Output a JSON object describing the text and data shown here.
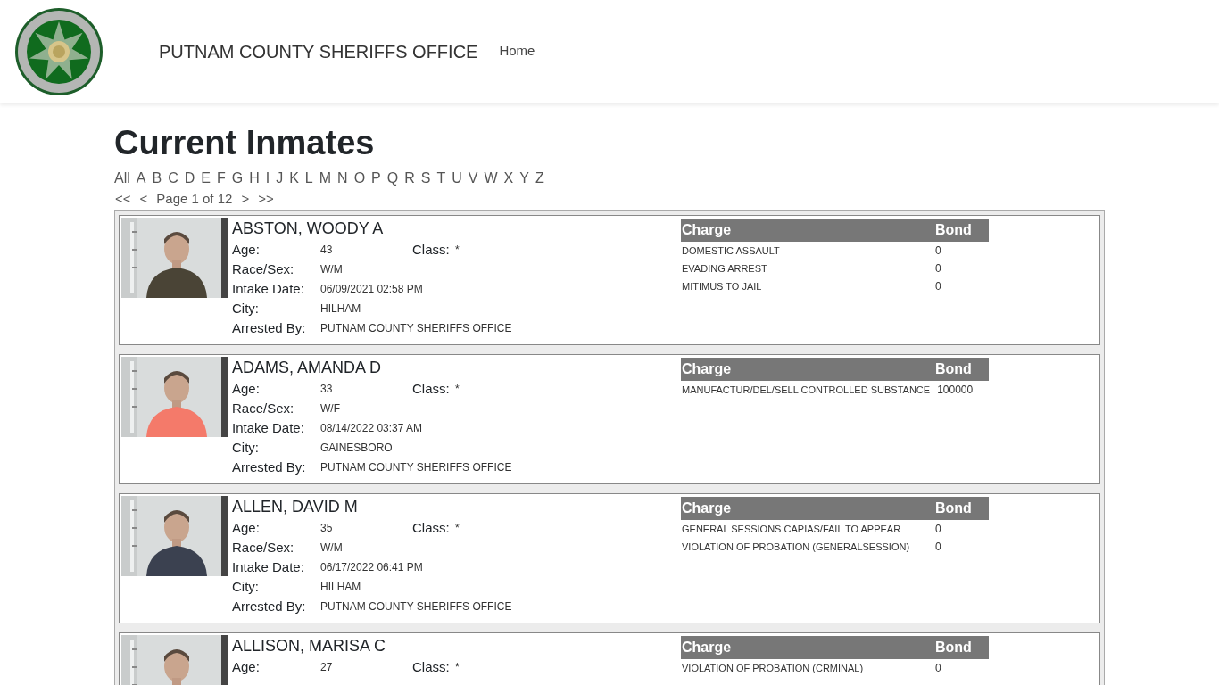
{
  "header": {
    "title": "PUTNAM COUNTY SHERIFFS OFFICE",
    "nav": [
      {
        "label": "Home"
      }
    ]
  },
  "page_title": "Current Inmates",
  "letters": [
    "All",
    "A",
    "B",
    "C",
    "D",
    "E",
    "F",
    "G",
    "H",
    "I",
    "J",
    "K",
    "L",
    "M",
    "N",
    "O",
    "P",
    "Q",
    "R",
    "S",
    "T",
    "U",
    "V",
    "W",
    "X",
    "Y",
    "Z"
  ],
  "pager": {
    "first": "<<",
    "prev": "<",
    "label": "Page 1 of 12",
    "next": ">",
    "last": ">>"
  },
  "inmates": [
    {
      "name": "ABSTON, WOODY A",
      "details": [
        {
          "label": "Age:",
          "value": "43"
        },
        {
          "label": "Race/Sex:",
          "value": "W/M"
        },
        {
          "label": "Intake Date:",
          "value": "06/09/2021 02:58 PM"
        },
        {
          "label": "City:",
          "value": "HILHAM"
        },
        {
          "label": "Arrested By:",
          "value": "PUTNAM COUNTY SHERIFFS OFFICE"
        }
      ],
      "class": {
        "label": "Class:",
        "value": "*"
      },
      "charge_header": "Charge",
      "bond_header": "Bond",
      "charges": [
        {
          "charge": "DOMESTIC ASSAULT",
          "bond": "0"
        },
        {
          "charge": "EVADING ARREST",
          "bond": "0"
        },
        {
          "charge": "MITIMUS TO JAIL",
          "bond": "0"
        }
      ]
    },
    {
      "name": "ADAMS, AMANDA D",
      "details": [
        {
          "label": "Age:",
          "value": "33"
        },
        {
          "label": "Race/Sex:",
          "value": "W/F"
        },
        {
          "label": "Intake Date:",
          "value": "08/14/2022 03:37 AM"
        },
        {
          "label": "City:",
          "value": "GAINESBORO"
        },
        {
          "label": "Arrested By:",
          "value": "PUTNAM COUNTY SHERIFFS OFFICE"
        }
      ],
      "class": {
        "label": "Class:",
        "value": "*"
      },
      "charge_header": "Charge",
      "bond_header": "Bond",
      "charges": [
        {
          "charge": "MANUFACTUR/DEL/SELL CONTROLLED SUBSTANCE",
          "bond": "100000"
        }
      ]
    },
    {
      "name": "ALLEN, DAVID M",
      "details": [
        {
          "label": "Age:",
          "value": "35"
        },
        {
          "label": "Race/Sex:",
          "value": "W/M"
        },
        {
          "label": "Intake Date:",
          "value": "06/17/2022 06:41 PM"
        },
        {
          "label": "City:",
          "value": "HILHAM"
        },
        {
          "label": "Arrested By:",
          "value": "PUTNAM COUNTY SHERIFFS OFFICE"
        }
      ],
      "class": {
        "label": "Class:",
        "value": "*"
      },
      "charge_header": "Charge",
      "bond_header": "Bond",
      "charges": [
        {
          "charge": "GENERAL SESSIONS CAPIAS/FAIL TO APPEAR",
          "bond": "0"
        },
        {
          "charge": "VIOLATION OF PROBATION (GENERALSESSION)",
          "bond": "0"
        }
      ]
    },
    {
      "name": "ALLISON, MARISA C",
      "details": [
        {
          "label": "Age:",
          "value": "27"
        }
      ],
      "class": {
        "label": "Class:",
        "value": "*"
      },
      "charge_header": "Charge",
      "bond_header": "Bond",
      "charges": [
        {
          "charge": "VIOLATION OF PROBATION (CRMINAL)",
          "bond": "0"
        }
      ]
    }
  ]
}
